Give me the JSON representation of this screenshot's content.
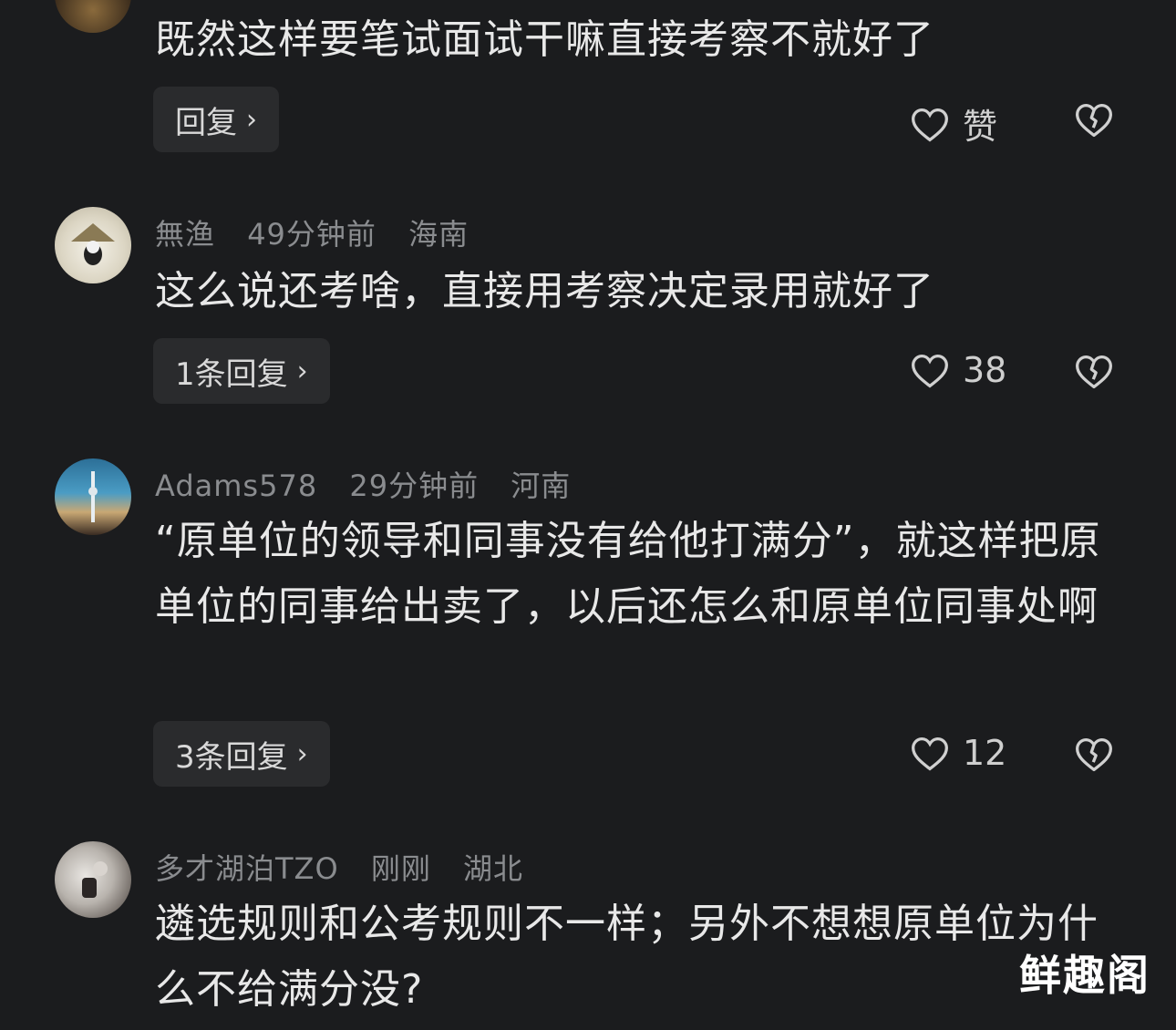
{
  "comments": [
    {
      "text": "既然这样要笔试面试干嘛直接考察不就好了",
      "reply_label": "回复",
      "like_label": "赞"
    },
    {
      "user": "無渔",
      "time": "49分钟前",
      "location": "海南",
      "text": "这么说还考啥，直接用考察决定录用就好了",
      "reply_label": "1条回复",
      "like_label": "38"
    },
    {
      "user": "Adams578",
      "time": "29分钟前",
      "location": "河南",
      "text": "“原单位的领导和同事没有给他打满分”，就这样把原单位的同事给出卖了，以后还怎么和原单位同事处啊",
      "reply_label": "3条回复",
      "like_label": "12"
    },
    {
      "user": "多才湖泊TZO",
      "time": "刚刚",
      "location": "湖北",
      "text": "遴选规则和公考规则不一样；另外不想想原单位为什么不给满分没?"
    }
  ],
  "watermark": "鲜趣阁",
  "icons": {
    "like": "heart-outline-icon",
    "dislike": "broken-heart-icon",
    "reply_chevron": "chevron-right-icon"
  }
}
